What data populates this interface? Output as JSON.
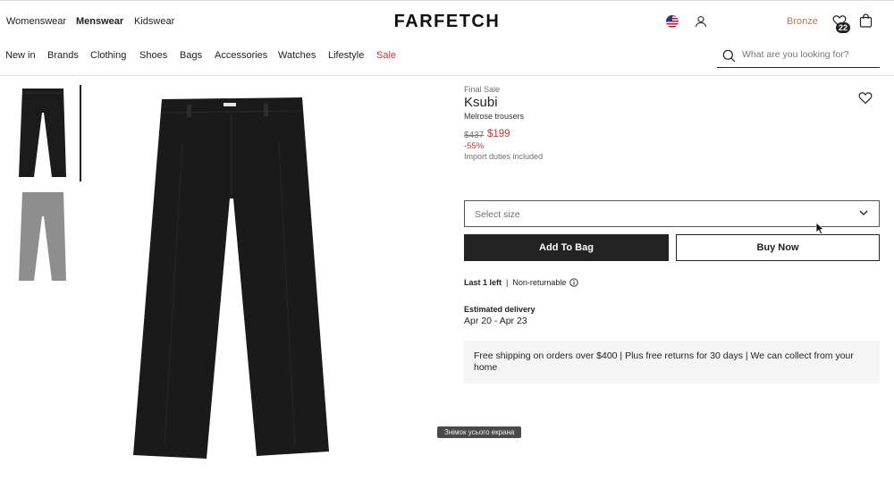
{
  "header": {
    "departments": [
      {
        "label": "Womenswear",
        "active": false
      },
      {
        "label": "Menswear",
        "active": true
      },
      {
        "label": "Kidswear",
        "active": false
      }
    ],
    "logo": "FARFETCH",
    "account_tier": "Bronze",
    "wishlist_count": "22",
    "icons": [
      "us-flag-icon",
      "user-icon",
      "wishlist-heart-icon",
      "bag-icon"
    ]
  },
  "nav": {
    "items": [
      "New in",
      "Brands",
      "Clothing",
      "Shoes",
      "Bags",
      "Accessories",
      "Watches",
      "Lifestyle",
      "Sale"
    ],
    "search_placeholder": "What are you looking for?"
  },
  "product": {
    "tag": "Final Sale",
    "brand": "Ksubi",
    "name": "Melrose trousers",
    "original_price": "$437",
    "sale_price": "$199",
    "discount": "-55%",
    "duties_note": "Import duties included",
    "size_placeholder": "Select size",
    "add_to_bag": "Add To Bag",
    "buy_now": "Buy Now",
    "stock": "Last 1 left",
    "returns": "Non-returnable",
    "delivery_label": "Estimated delivery",
    "delivery_dates": "Apr 20 - Apr 23",
    "shipping_info": "Free shipping on orders over $400 | Plus free returns for 30 days | We can collect from your home"
  },
  "overlay": {
    "screenshot_tooltip": "Знімок усього екрана"
  },
  "colors": {
    "sale_red": "#d0372a",
    "bronze": "#b07a4f",
    "primary_button": "#222222"
  }
}
